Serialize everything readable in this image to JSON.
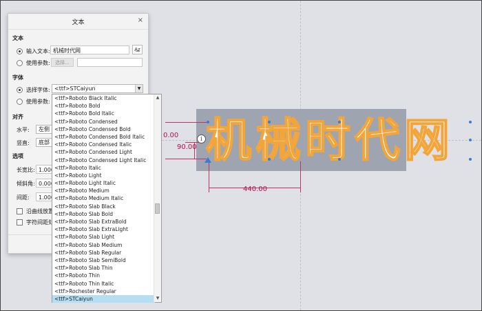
{
  "dialog": {
    "title": "文本",
    "close": "×",
    "text_section": "文本",
    "input_text_label": "输入文本:",
    "input_text_value": "机械时代网",
    "use_param_label": "使用参数:",
    "select_button": "选择...",
    "font_section": "字体",
    "select_font_label": "选择字体:",
    "selected_font": "<ttf>STCaiyun",
    "use_param_label2": "使用参数:",
    "align_section": "对齐",
    "horizontal_label": "水平:",
    "horizontal_value": "左侧",
    "vertical_label": "竖直:",
    "vertical_value": "底部",
    "options_section": "选项",
    "aspect_label": "长宽比:",
    "aspect_value": "1.000",
    "slant_label": "倾斜角:",
    "slant_value": "0.000",
    "spacing_label": "间距:",
    "spacing_value": "1.000",
    "along_curve_label": "沿曲线放置",
    "char_spacing_label": "字符间距处"
  },
  "font_list": [
    "<ttf>Roboto Black Italic",
    "<ttf>Roboto Bold",
    "<ttf>Roboto Bold Italic",
    "<ttf>Roboto Condensed",
    "<ttf>Roboto Condensed Bold",
    "<ttf>Roboto Condensed Bold Italic",
    "<ttf>Roboto Condensed Italic",
    "<ttf>Roboto Condensed Light",
    "<ttf>Roboto Condensed Light Italic",
    "<ttf>Roboto Italic",
    "<ttf>Roboto Light",
    "<ttf>Roboto Light Italic",
    "<ttf>Roboto Medium",
    "<ttf>Roboto Medium Italic",
    "<ttf>Roboto Slab Black",
    "<ttf>Roboto Slab Bold",
    "<ttf>Roboto Slab ExtraBold",
    "<ttf>Roboto Slab ExtraLight",
    "<ttf>Roboto Slab Light",
    "<ttf>Roboto Slab Medium",
    "<ttf>Roboto Slab Regular",
    "<ttf>Roboto Slab SemiBold",
    "<ttf>Roboto Slab Thin",
    "<ttf>Roboto Thin",
    "<ttf>Roboto Thin Italic",
    "<ttf>Rochester Regular",
    "<ttf>STCaiyun"
  ],
  "canvas": {
    "text": "机械时代网",
    "dim_height_partial": "0.00",
    "dim_height": "90.00",
    "dim_width": "440.00",
    "text_outline_color": "#f2a53a",
    "text_fill_color": "#ffffff",
    "text_box_color": "#9ea5b0",
    "dimension_color": "#b0124a"
  }
}
